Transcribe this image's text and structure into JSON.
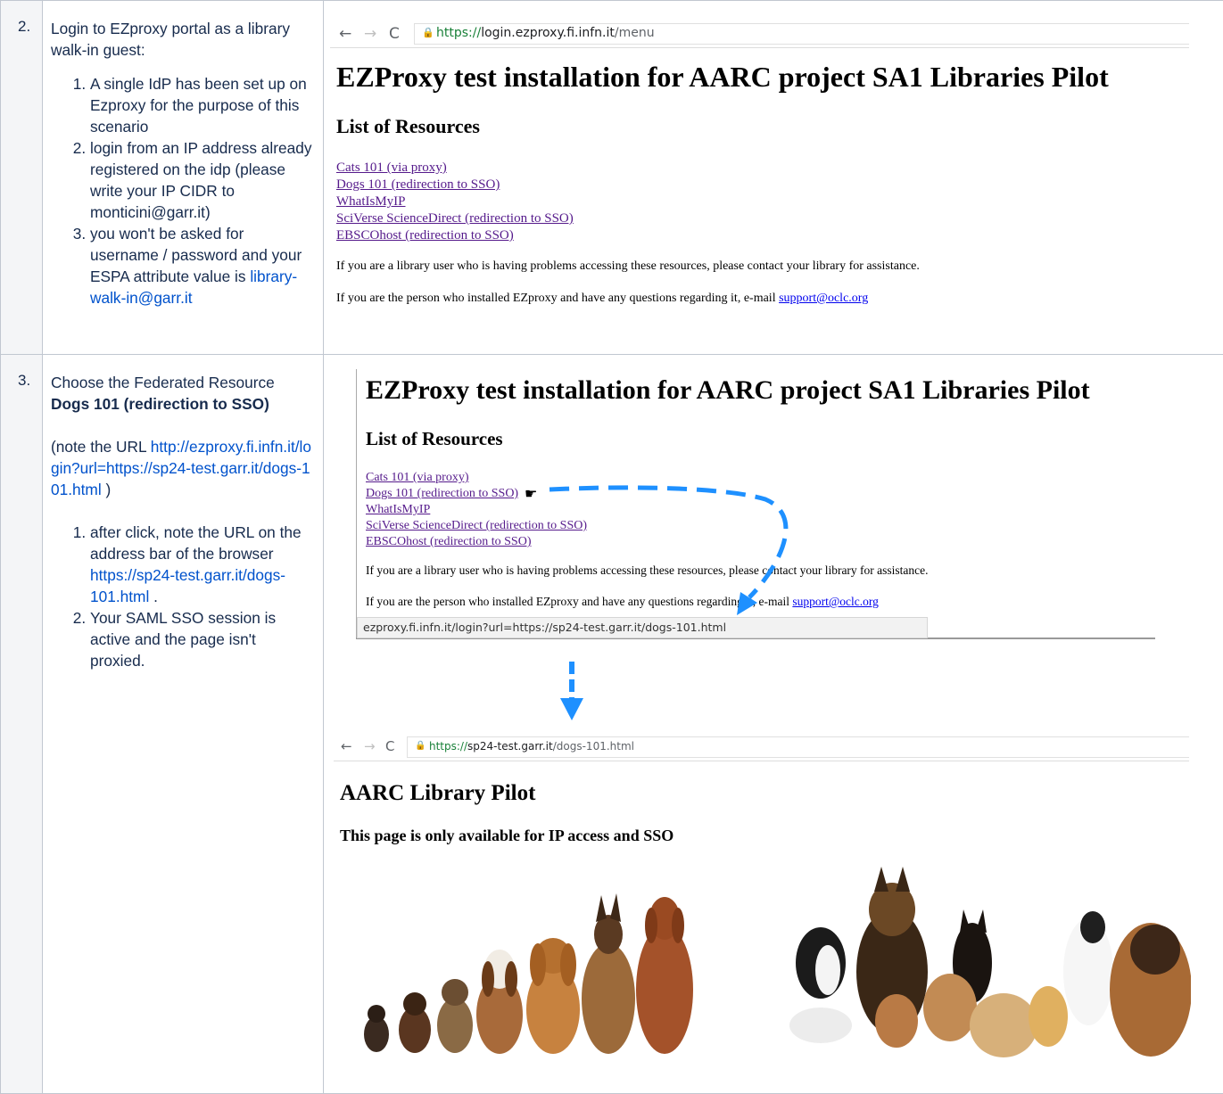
{
  "rows": [
    {
      "num": "2.",
      "title": "Login to EZproxy portal as a library walk-in guest:",
      "items": [
        "A single IdP has been set up on Ezproxy  for the purpose of this scenario",
        "login from an IP address already registered on the idp (please write your IP CIDR to monticini@garr.it)",
        "you won't be asked for username / password and your ESPA attribute value is "
      ],
      "item3_link": "library-walk-in@garr.it"
    },
    {
      "num": "3.",
      "title_prefix": "Choose the Federated Resource ",
      "title_bold": "Dogs 101 (redirection to SSO)",
      "note_prefix": "(note the URL ",
      "note_link": "http://ezproxy.fi.infn.it/login?url=https://sp24-test.garr.it/dogs-101.html",
      "note_suffix": " )",
      "item1_prefix": "after click, note the URL on the address bar of the browser ",
      "item1_link": "https://sp24-test.garr.it/dogs-101.html",
      "item1_suffix": " .",
      "item2": "Your SAML SSO session is active and the page isn't proxied."
    }
  ],
  "shot1": {
    "url_scheme": "https://",
    "url_host": "login.ezproxy.fi.infn.it",
    "url_path": "/menu",
    "heading": "EZProxy test installation for AARC project SA1 Libraries Pilot",
    "subheading": "List of Resources",
    "resources": [
      "Cats 101 (via proxy)",
      "Dogs 101 (redirection to SSO)",
      "WhatIsMyIP",
      "SciVerse ScienceDirect (redirection to SSO)",
      "EBSCOhost (redirection to SSO)"
    ],
    "para1": "If you are a library user who is having problems accessing these resources, please contact your library for assistance.",
    "para2_prefix": "If you are the person who installed EZproxy and have any questions regarding it, e-mail ",
    "para2_link": "support@oclc.org"
  },
  "shot2": {
    "heading": "EZProxy test installation for AARC project SA1 Libraries Pilot",
    "subheading": "List of Resources",
    "resources": [
      "Cats 101 (via proxy)",
      "Dogs 101 (redirection to SSO)",
      "WhatIsMyIP",
      "SciVerse ScienceDirect (redirection to SSO)",
      "EBSCOhost (redirection to SSO)"
    ],
    "para1": "If you are a library user who is having problems accessing these resources, please contact your library for assistance.",
    "para2_prefix": "If you are the person who installed EZproxy and have any questions regarding it, e-mail ",
    "para2_link": "support@oclc.org",
    "status_url": "ezproxy.fi.infn.it/login?url=https://sp24-test.garr.it/dogs-101.html"
  },
  "shot3": {
    "url_scheme": "https://",
    "url_host": "sp24-test.garr.it",
    "url_path": "/dogs-101.html",
    "heading": "AARC Library Pilot",
    "subheading": "This page is only available for IP access and SSO"
  },
  "colors": {
    "link": "#0052cc",
    "arrow": "#1e90ff",
    "border": "#c1c7d0"
  }
}
